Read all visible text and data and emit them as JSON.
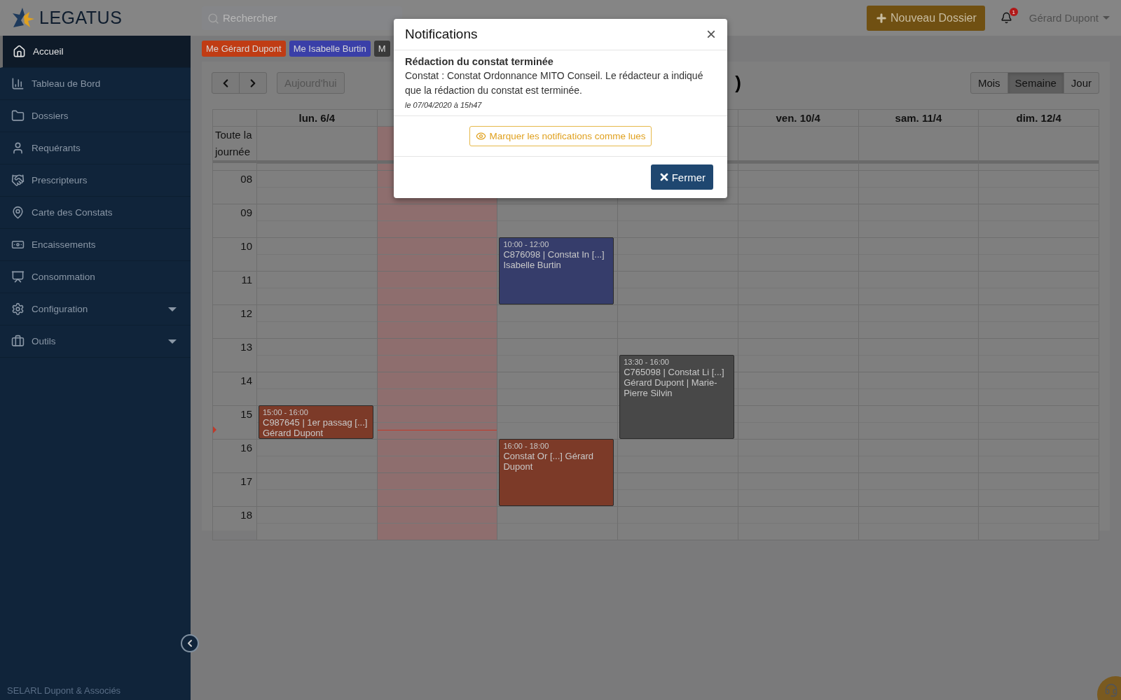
{
  "brand": {
    "name": "LEGATUS"
  },
  "search": {
    "placeholder": "Rechercher"
  },
  "new_button": {
    "label": "Nouveau Dossier"
  },
  "notifications": {
    "badge": "1"
  },
  "user": {
    "name": "Gérard Dupont"
  },
  "sidebar": {
    "items": [
      {
        "label": "Accueil",
        "selected": true,
        "expandable": false
      },
      {
        "label": "Tableau de Bord",
        "selected": false,
        "expandable": false
      },
      {
        "label": "Dossiers",
        "selected": false,
        "expandable": false
      },
      {
        "label": "Requérants",
        "selected": false,
        "expandable": false
      },
      {
        "label": "Prescripteurs",
        "selected": false,
        "expandable": false
      },
      {
        "label": "Carte des Constats",
        "selected": false,
        "expandable": false
      },
      {
        "label": "Encaissements",
        "selected": false,
        "expandable": false
      },
      {
        "label": "Consommation",
        "selected": false,
        "expandable": false
      },
      {
        "label": "Configuration",
        "selected": false,
        "expandable": true
      },
      {
        "label": "Outils",
        "selected": false,
        "expandable": true
      }
    ],
    "footer": "SELARL Dupont & Associés"
  },
  "filters": [
    {
      "label": "Me Gérard Dupont",
      "color": "#c03c14"
    },
    {
      "label": "Me Isabelle Burtin",
      "color": "#3a3fa8"
    },
    {
      "label": "M",
      "color": "#3a3a3a"
    }
  ],
  "calendar": {
    "title": ")",
    "today_button": {
      "label": "Aujourd'hui",
      "disabled": true
    },
    "views": [
      {
        "label": "Mois",
        "selected": false
      },
      {
        "label": "Semaine",
        "selected": true
      },
      {
        "label": "Jour",
        "selected": false
      }
    ],
    "all_day_label": "Toute la journée",
    "hours": [
      "08",
      "09",
      "10",
      "11",
      "12",
      "13",
      "14",
      "15",
      "16",
      "17",
      "18"
    ],
    "columns": [
      {
        "label": "lun. 6/4",
        "today": false,
        "events": [
          {
            "time": "15:00 - 16:00",
            "lines": [
              "C987645 | 1er passag [...]",
              "Gérard Dupont"
            ],
            "color": "#7c3a28"
          }
        ]
      },
      {
        "today": true,
        "now_line": {
          "level": 0.708
        }
      },
      {
        "today": false,
        "events": [
          {
            "time": "10:00 - 12:00",
            "lines": [
              "C876098 | Constat In [...]",
              "Isabelle Burtin"
            ],
            "color": "#363d6b"
          },
          {
            "time": "16:00 - 18:00",
            "lines": [
              "Constat Or [...] Gérard Dupont"
            ],
            "color": "#7c3a28"
          }
        ]
      },
      {
        "today": false,
        "events": [
          {
            "time": "13:30 - 16:00",
            "lines": [
              "C765098 | Constat Li [...]",
              "Gérard Dupont | Marie-Pierre Silvin"
            ],
            "color": "#484848"
          }
        ]
      },
      {
        "label": "ven. 10/4",
        "today": false
      },
      {
        "label": "sam. 11/4",
        "today": false
      },
      {
        "label": "dim. 12/4",
        "today": false
      }
    ]
  },
  "modal": {
    "title": "Notifications",
    "close_glyph": "×",
    "items": [
      {
        "title": "Rédaction du constat terminée",
        "text": "Constat : Constat Ordonnance MITO Conseil. Le rédacteur a indiqué que la rédaction du constat est terminée.",
        "date": "le 07/04/2020 à 15h47"
      }
    ],
    "mark_read": "Marquer les notifications comme lues",
    "close": "Fermer"
  }
}
